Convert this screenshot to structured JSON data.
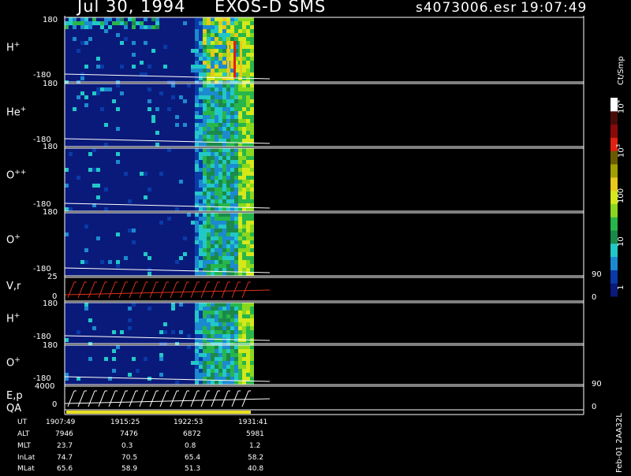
{
  "header": {
    "date": "Jul 30, 1994",
    "instrument": "EXOS-D SMS",
    "file": "s4073006.esr",
    "time": "19:07:49"
  },
  "panels": [
    {
      "id": "h-plus-1",
      "label": "H",
      "sup": "+",
      "top": "180",
      "bottom": "-180"
    },
    {
      "id": "he-plus",
      "label": "He",
      "sup": "+",
      "top": "180",
      "bottom": "-180"
    },
    {
      "id": "o-plus-plus",
      "label": "O",
      "sup": "++",
      "top": "180",
      "bottom": "-180"
    },
    {
      "id": "o-plus-1",
      "label": "O",
      "sup": "+",
      "top": "180",
      "bottom": "-180"
    },
    {
      "id": "velocity",
      "label": "V,r",
      "sup": "",
      "top": "25",
      "bottom": "0",
      "right_top": "90",
      "right_bottom": "0"
    },
    {
      "id": "h-plus-2",
      "label": "H",
      "sup": "+",
      "top": "180",
      "bottom": "-180"
    },
    {
      "id": "o-plus-2",
      "label": "O",
      "sup": "+",
      "top": "180",
      "bottom": "-180"
    },
    {
      "id": "energy",
      "label": "E,p",
      "sup": "",
      "top": "4000",
      "bottom": "0",
      "right_top": "90",
      "right_bottom": "0"
    }
  ],
  "qa_label": "QA",
  "colorbar": {
    "unit": "Ct/Smp",
    "ticks": [
      "10",
      "4",
      "10",
      "3",
      "100",
      "10",
      "1"
    ],
    "tick_labels": {
      "t1e4": "10",
      "t1e4_exp": "4",
      "t1e3": "10",
      "t1e3_exp": "3",
      "t100": "100",
      "t10": "10",
      "t1": "1"
    },
    "colors": [
      "#0a1a7a",
      "#0a3aa8",
      "#1c8ad0",
      "#22c8c8",
      "#1a8a4a",
      "#27b64a",
      "#8ad81e",
      "#d4e81a",
      "#e8c81a",
      "#a0a000",
      "#6a5a00",
      "#e02010",
      "#8a0a0a",
      "#4a0a0a",
      "#ffffff"
    ]
  },
  "footer": {
    "rows": [
      {
        "name": "UT",
        "values": [
          "1907:49",
          "1915:25",
          "1922:53",
          "1931:41"
        ]
      },
      {
        "name": "ALT",
        "values": [
          "7946",
          "7476",
          "6872",
          "5981"
        ]
      },
      {
        "name": "MLT",
        "values": [
          "23.7",
          "0.3",
          "0.8",
          "1.2"
        ]
      },
      {
        "name": "InLat",
        "values": [
          "74.7",
          "70.5",
          "65.4",
          "58.2"
        ]
      },
      {
        "name": "MLat",
        "values": [
          "65.6",
          "58.9",
          "51.3",
          "40.8"
        ]
      }
    ],
    "stamp": "Feb-01 2AA32L"
  },
  "chart_data": {
    "type": "heatmap",
    "title": "Jul 30, 1994   EXOS-D SMS",
    "x_ticks": [
      "1907:49",
      "1915:25",
      "1922:53",
      "1931:41"
    ],
    "panels": [
      "H+",
      "He+",
      "O++",
      "O+",
      "V,r",
      "H+",
      "O+",
      "E,p"
    ],
    "y_range": [
      -180,
      180
    ],
    "colorbar_unit": "Ct/Smp",
    "colorbar_range": [
      1,
      10000
    ],
    "scale": "log"
  }
}
